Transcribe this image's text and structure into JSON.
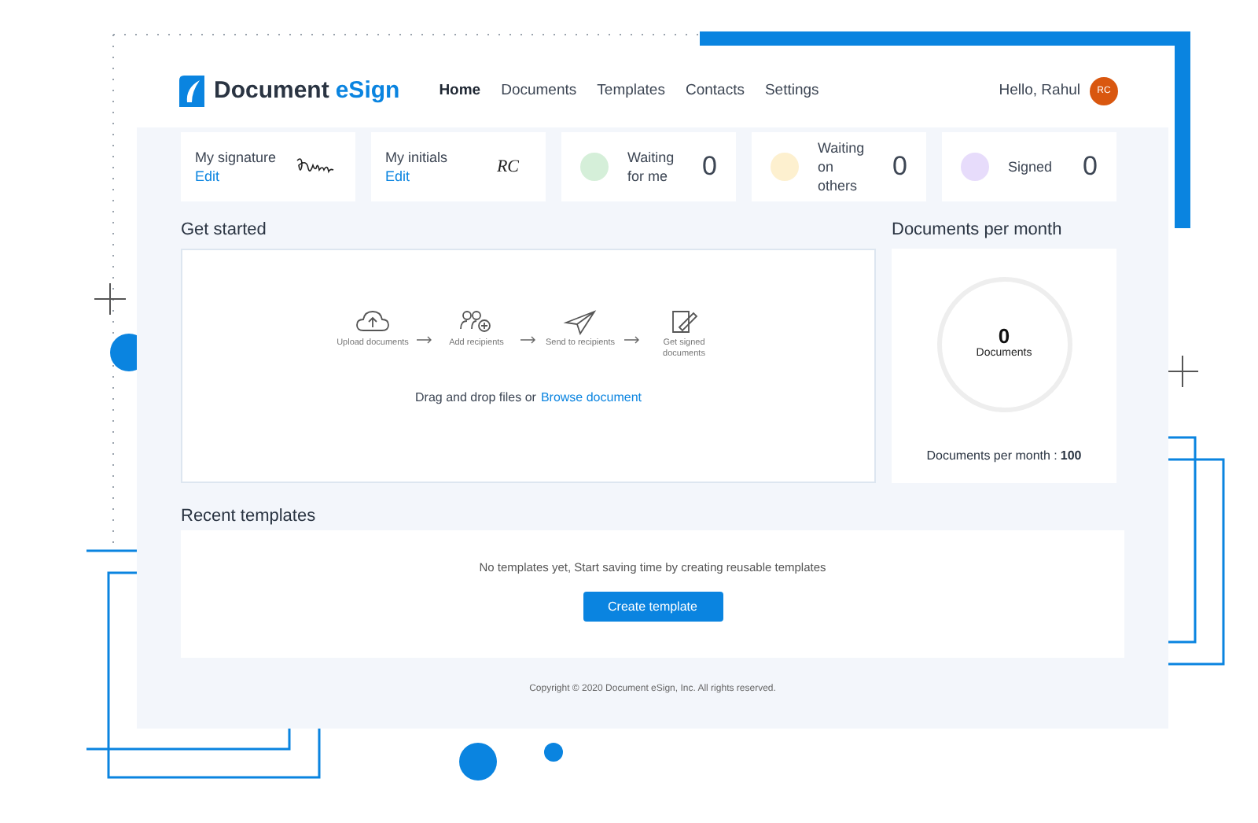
{
  "header": {
    "logo_first": "Document",
    "logo_second": "eSign",
    "greeting": "Hello, Rahul",
    "avatar": "RC",
    "nav": [
      {
        "label": "Home",
        "selected": true
      },
      {
        "label": "Documents",
        "selected": false
      },
      {
        "label": "Templates",
        "selected": false
      },
      {
        "label": "Contacts",
        "selected": false
      },
      {
        "label": "Settings",
        "selected": false
      }
    ]
  },
  "cards": [
    {
      "kind": "signature",
      "label": "My signature",
      "action": "Edit"
    },
    {
      "kind": "initials",
      "label": "My initials",
      "action": "Edit",
      "initials": "RC"
    },
    {
      "kind": "stat",
      "label": "Waiting for me",
      "count": "0",
      "color": "#d5efd9"
    },
    {
      "kind": "stat",
      "label": "Waiting on others",
      "count": "0",
      "color": "#fdf0cf"
    },
    {
      "kind": "stat",
      "label": "Signed",
      "count": "0",
      "color": "#e7dcfb"
    }
  ],
  "get_started": {
    "title": "Get started",
    "drop_text": "Drag and drop files or",
    "browse_link": "Browse document",
    "steps": [
      {
        "kind": "upload",
        "label": "Upload documents"
      },
      {
        "kind": "recipients",
        "label": "Add recipients"
      },
      {
        "kind": "send",
        "label": "Send to recipients"
      },
      {
        "kind": "signed",
        "label": "Get signed documents"
      }
    ]
  },
  "documents_per_month": {
    "title": "Documents per month",
    "count": "0",
    "unit": "Documents",
    "limit_label": "Documents per month :",
    "limit": "100"
  },
  "recent_templates": {
    "title": "Recent templates",
    "empty_text": "No templates yet, Start saving time by creating reusable templates",
    "button": "Create template"
  },
  "footer": "Copyright © 2020 Document eSign, Inc. All rights reserved."
}
